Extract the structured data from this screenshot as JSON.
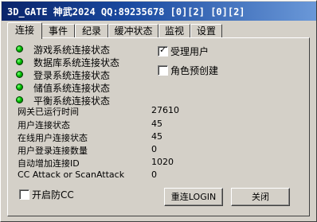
{
  "window": {
    "title": "3D_GATE 神武2024 QQ:89235678 [0][2] [0][2]"
  },
  "tabs": [
    {
      "label": "连接"
    },
    {
      "label": "事件"
    },
    {
      "label": "纪录"
    },
    {
      "label": "缓冲状态"
    },
    {
      "label": "监视"
    },
    {
      "label": "设置"
    }
  ],
  "status_indicators": [
    {
      "label": "游戏系统连接状态",
      "color": "#00c000"
    },
    {
      "label": "数据库系统连接状态",
      "color": "#00c000"
    },
    {
      "label": "登录系统连接状态",
      "color": "#00c000"
    },
    {
      "label": "储值系统连接状态",
      "color": "#00c000"
    },
    {
      "label": "平衡系统连接状态",
      "color": "#00c000"
    }
  ],
  "options": {
    "accept_users": {
      "label": "受理用户",
      "checked": true
    },
    "role_pre_create": {
      "label": "角色预创建",
      "checked": false
    }
  },
  "stats": [
    {
      "label": "网关已运行时间",
      "value": "27610"
    },
    {
      "label": "用户连接状态",
      "value": "45"
    },
    {
      "label": "在线用户连接状态",
      "value": "45"
    },
    {
      "label": "用户登录连接数量",
      "value": "0"
    },
    {
      "label": "自动增加连接ID",
      "value": "1020"
    },
    {
      "label": "CC Attack or ScanAttack",
      "value": "0"
    }
  ],
  "anti_cc": {
    "label": "开启防CC",
    "checked": false
  },
  "buttons": {
    "reconnect_login": "重连LOGIN",
    "close": "关闭"
  }
}
